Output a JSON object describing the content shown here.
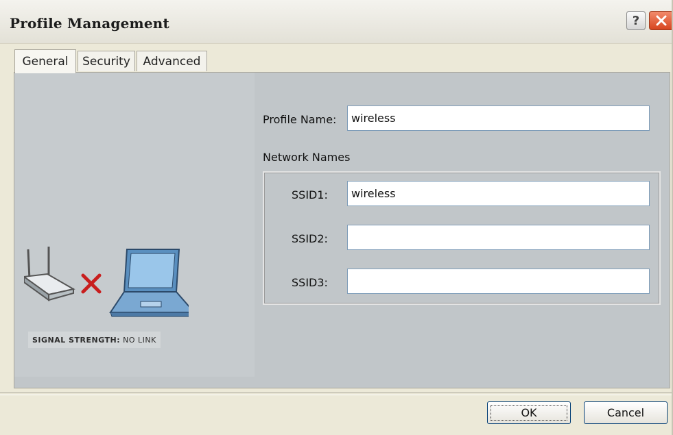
{
  "window": {
    "title": "Profile Management"
  },
  "tabs": [
    {
      "label": "General",
      "active": true
    },
    {
      "label": "Security",
      "active": false
    },
    {
      "label": "Advanced",
      "active": false
    }
  ],
  "status": {
    "signal_label": "SIGNAL STRENGTH:",
    "signal_value": "NO LINK",
    "icons": [
      "access-point-icon",
      "no-link-x-icon",
      "laptop-icon"
    ],
    "x_color": "#c81e1e"
  },
  "form": {
    "profile_name_label": "Profile Name:",
    "profile_name_value": "wireless",
    "network_names_label": "Network Names",
    "ssid1_label": "SSID1:",
    "ssid1_value": "wireless",
    "ssid2_label": "SSID2:",
    "ssid2_value": "",
    "ssid3_label": "SSID3:",
    "ssid3_value": ""
  },
  "buttons": {
    "ok_label": "OK",
    "cancel_label": "Cancel"
  },
  "title_buttons": {
    "help_label": "?"
  },
  "colors": {
    "panel_bg": "#c1c6c9",
    "window_bg": "#ece9d8",
    "close_button": "#d7451f"
  }
}
